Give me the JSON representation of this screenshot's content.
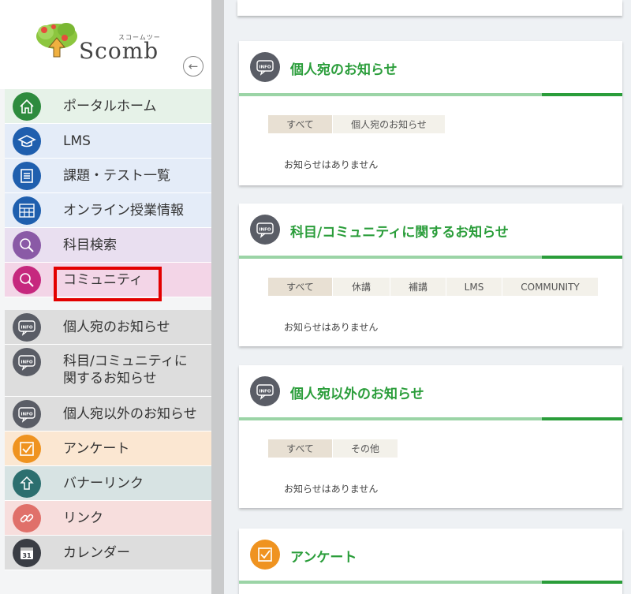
{
  "logo": {
    "kana": "スコームツー",
    "text": "Scomb"
  },
  "sidebar": {
    "items": [
      {
        "label": "ポータルホーム",
        "icon": "home-icon",
        "bg": "#e6f2e8",
        "iconColor": "#2e8b3e"
      },
      {
        "label": "LMS",
        "icon": "graduation-cap-icon",
        "bg": "#e4ecf8",
        "iconColor": "#1f5fae"
      },
      {
        "label": "課題・テスト一覧",
        "icon": "document-list-icon",
        "bg": "#e4ecf8",
        "iconColor": "#1f5fae"
      },
      {
        "label": "オンライン授業情報",
        "icon": "class-grid-icon",
        "bg": "#e4ecf8",
        "iconColor": "#1f5fae"
      },
      {
        "label": "科目検索",
        "icon": "search-icon",
        "bg": "#e9dff0",
        "iconColor": "#8a5aa6"
      },
      {
        "label": "コミュニティ",
        "icon": "search-icon",
        "bg": "#f3d5e7",
        "iconColor": "#c6287e"
      },
      {
        "label": "個人宛のお知らせ",
        "icon": "info-bubble-icon",
        "bg": "#dddddd",
        "iconColor": "#5a5d66"
      },
      {
        "label": "科目/コミュニティに",
        "label2": "関するお知らせ",
        "icon": "info-bubble-icon",
        "bg": "#dddddd",
        "iconColor": "#5a5d66"
      },
      {
        "label": "個人宛以外のお知らせ",
        "icon": "info-bubble-icon",
        "bg": "#dddddd",
        "iconColor": "#5a5d66"
      },
      {
        "label": "アンケート",
        "icon": "checkbox-icon",
        "bg": "#fbe7d2",
        "iconColor": "#ef9320"
      },
      {
        "label": "バナーリンク",
        "icon": "arrow-up-icon",
        "bg": "#d7e3e3",
        "iconColor": "#2c6f6f"
      },
      {
        "label": "リンク",
        "icon": "link-icon",
        "bg": "#f7dedd",
        "iconColor": "#e0706a"
      },
      {
        "label": "カレンダー",
        "icon": "calendar-icon",
        "bg": "#dddddd",
        "iconColor": "#3a3d44",
        "calendarDay": "31"
      }
    ]
  },
  "main": {
    "cards": [
      {
        "title": "個人宛のお知らせ",
        "icon": "info-bubble-icon",
        "iconBadge": "INFO",
        "tabs": [
          "すべて",
          "個人宛のお知らせ"
        ],
        "empty": "お知らせはありません"
      },
      {
        "title": "科目/コミュニティに関するお知らせ",
        "icon": "info-bubble-icon",
        "iconBadge": "INFO",
        "tabs": [
          "すべて",
          "休講",
          "補講",
          "LMS",
          "COMMUNITY"
        ],
        "empty": "お知らせはありません"
      },
      {
        "title": "個人宛以外のお知らせ",
        "icon": "info-bubble-icon",
        "iconBadge": "INFO",
        "tabs": [
          "すべて",
          "その他"
        ],
        "empty": "お知らせはありません"
      },
      {
        "title": "アンケート",
        "icon": "checkbox-icon",
        "tabs": [],
        "empty": ""
      }
    ]
  },
  "colors": {
    "accent": "#2a9d3a",
    "highlight": "#e30000"
  }
}
